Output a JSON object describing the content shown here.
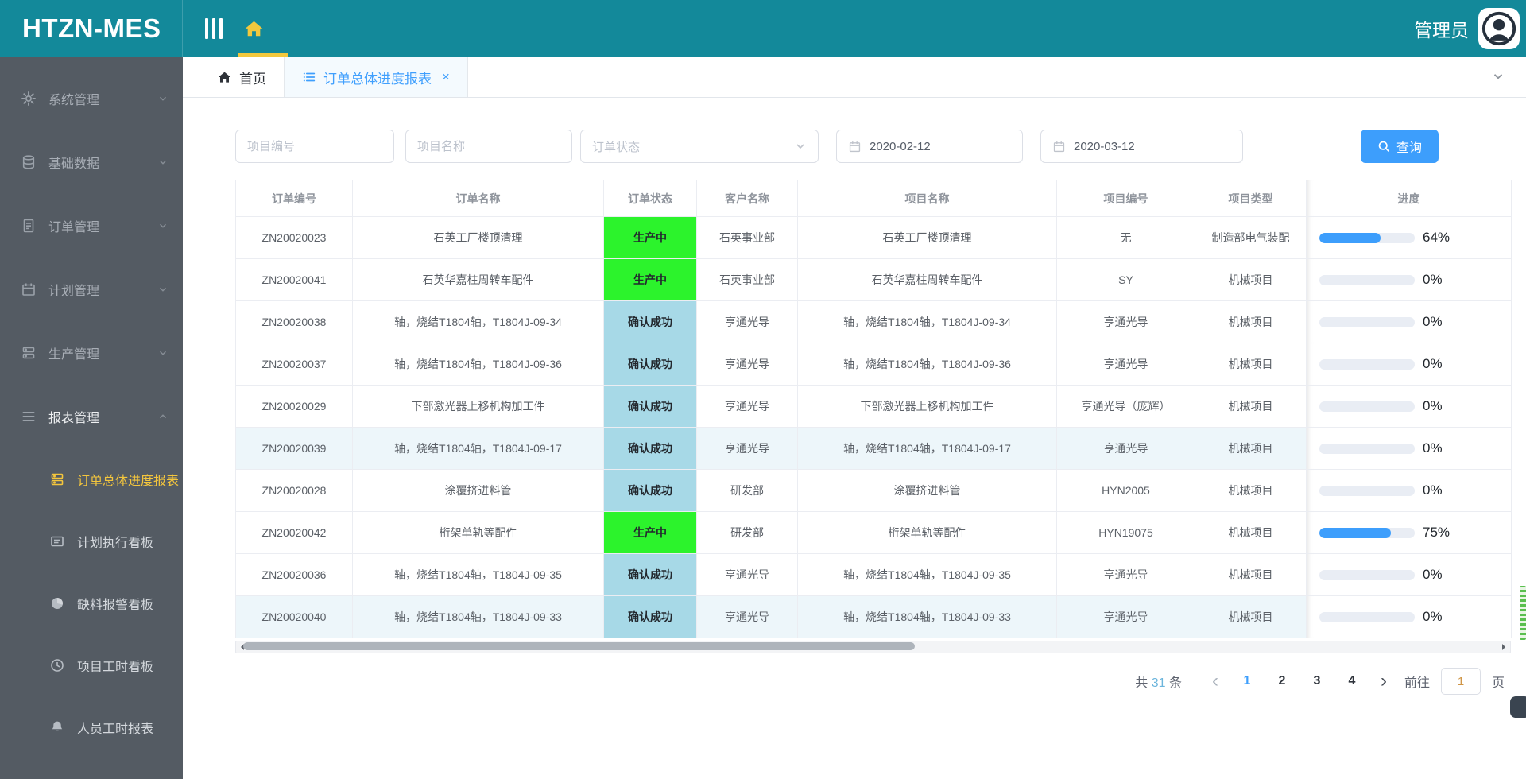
{
  "header": {
    "logo": "HTZN-MES",
    "user_label": "管理员"
  },
  "colors": {
    "header_teal": "#13899a",
    "sidebar_bg": "#545b63",
    "accent_blue": "#3d9efc",
    "active_yellow": "#f4c63d"
  },
  "sidebar": {
    "items": [
      {
        "label": "系统管理",
        "icon": "gear-icon",
        "state": "collapsed"
      },
      {
        "label": "基础数据",
        "icon": "database-icon",
        "state": "collapsed"
      },
      {
        "label": "订单管理",
        "icon": "order-doc-icon",
        "state": "collapsed"
      },
      {
        "label": "计划管理",
        "icon": "calendar-icon",
        "state": "collapsed"
      },
      {
        "label": "生产管理",
        "icon": "production-icon",
        "state": "collapsed"
      },
      {
        "label": "报表管理",
        "icon": "report-menu-icon",
        "state": "expanded",
        "children": [
          {
            "label": "订单总体进度报表",
            "icon": "order-progress-report-icon",
            "active": true
          },
          {
            "label": "计划执行看板",
            "icon": "plan-board-icon"
          },
          {
            "label": "缺料报警看板",
            "icon": "shortage-alarm-icon"
          },
          {
            "label": "项目工时看板",
            "icon": "project-hours-icon"
          },
          {
            "label": "人员工时报表",
            "icon": "staff-hours-icon"
          }
        ]
      }
    ]
  },
  "tabs": [
    {
      "label": "首页",
      "icon": "home-icon"
    },
    {
      "label": "订单总体进度报表",
      "icon": "list-icon",
      "closable": true,
      "active": true
    }
  ],
  "filters": {
    "project_no_placeholder": "项目编号",
    "project_name_placeholder": "项目名称",
    "order_status_placeholder": "订单状态",
    "date_start": "2020-02-12",
    "date_end": "2020-03-12",
    "search_label": "查询"
  },
  "table": {
    "columns": [
      "订单编号",
      "订单名称",
      "订单状态",
      "客户名称",
      "项目名称",
      "项目编号",
      "项目类型",
      "进度"
    ],
    "status_colors": {
      "生产中": "#2cf32c",
      "确认成功": "#a7d9e7"
    },
    "rows": [
      {
        "order_no": "ZN20020023",
        "order_name": "石英工厂楼顶清理",
        "status": "生产中",
        "customer": "石英事业部",
        "project_name": "石英工厂楼顶清理",
        "project_no": "无",
        "project_type": "制造部电气装配",
        "progress": 64
      },
      {
        "order_no": "ZN20020041",
        "order_name": "石英华嘉柱周转车配件",
        "status": "生产中",
        "customer": "石英事业部",
        "project_name": "石英华嘉柱周转车配件",
        "project_no": "SY",
        "project_type": "机械项目",
        "progress": 0
      },
      {
        "order_no": "ZN20020038",
        "order_name": "轴，烧结T1804轴，T1804J-09-34",
        "status": "确认成功",
        "customer": "亨通光导",
        "project_name": "轴，烧结T1804轴，T1804J-09-34",
        "project_no": "亨通光导",
        "project_type": "机械项目",
        "progress": 0
      },
      {
        "order_no": "ZN20020037",
        "order_name": "轴，烧结T1804轴，T1804J-09-36",
        "status": "确认成功",
        "customer": "亨通光导",
        "project_name": "轴，烧结T1804轴，T1804J-09-36",
        "project_no": "亨通光导",
        "project_type": "机械项目",
        "progress": 0
      },
      {
        "order_no": "ZN20020029",
        "order_name": "下部激光器上移机构加工件",
        "status": "确认成功",
        "customer": "亨通光导",
        "project_name": "下部激光器上移机构加工件",
        "project_no": "亨通光导（庞辉）",
        "project_type": "机械项目",
        "progress": 0
      },
      {
        "order_no": "ZN20020039",
        "order_name": "轴，烧结T1804轴，T1804J-09-17",
        "status": "确认成功",
        "customer": "亨通光导",
        "project_name": "轴，烧结T1804轴，T1804J-09-17",
        "project_no": "亨通光导",
        "project_type": "机械项目",
        "progress": 0,
        "tinted": true
      },
      {
        "order_no": "ZN20020028",
        "order_name": "涂覆挤进料管",
        "status": "确认成功",
        "customer": "研发部",
        "project_name": "涂覆挤进料管",
        "project_no": "HYN2005",
        "project_type": "机械项目",
        "progress": 0
      },
      {
        "order_no": "ZN20020042",
        "order_name": "桁架单轨等配件",
        "status": "生产中",
        "customer": "研发部",
        "project_name": "桁架单轨等配件",
        "project_no": "HYN19075",
        "project_type": "机械项目",
        "progress": 75
      },
      {
        "order_no": "ZN20020036",
        "order_name": "轴，烧结T1804轴，T1804J-09-35",
        "status": "确认成功",
        "customer": "亨通光导",
        "project_name": "轴，烧结T1804轴，T1804J-09-35",
        "project_no": "亨通光导",
        "project_type": "机械项目",
        "progress": 0
      },
      {
        "order_no": "ZN20020040",
        "order_name": "轴，烧结T1804轴，T1804J-09-33",
        "status": "确认成功",
        "customer": "亨通光导",
        "project_name": "轴，烧结T1804轴，T1804J-09-33",
        "project_no": "亨通光导",
        "project_type": "机械项目",
        "progress": 0,
        "tinted": true
      }
    ]
  },
  "pagination": {
    "total_prefix": "共",
    "total": "31",
    "total_suffix": "条",
    "pages": [
      1,
      2,
      3,
      4
    ],
    "current": 1,
    "goto_label": "前往",
    "goto_value": "1",
    "page_label": "页"
  }
}
